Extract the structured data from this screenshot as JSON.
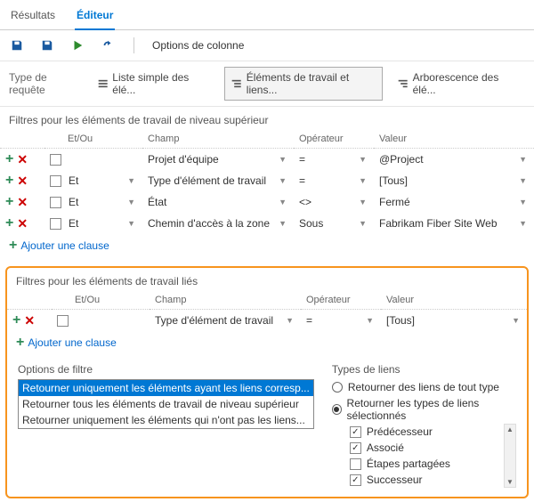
{
  "tabs": {
    "results": "Résultats",
    "editor": "Éditeur"
  },
  "toolbar": {
    "column_options": "Options de colonne"
  },
  "querytype": {
    "label": "Type de requête",
    "flat": "Liste simple des élé...",
    "links": "Éléments de travail et liens...",
    "tree": "Arborescence des élé..."
  },
  "top": {
    "title": "Filtres pour les éléments de travail de niveau supérieur",
    "headers": {
      "andor": "Et/Ou",
      "field": "Champ",
      "operator": "Opérateur",
      "value": "Valeur"
    },
    "rows": [
      {
        "andor": "",
        "field": "Projet d'équipe",
        "op": "=",
        "value": "@Project"
      },
      {
        "andor": "Et",
        "field": "Type d'élément de travail",
        "op": "=",
        "value": "[Tous]"
      },
      {
        "andor": "Et",
        "field": "État",
        "op": "<>",
        "value": "Fermé"
      },
      {
        "andor": "Et",
        "field": "Chemin d'accès à la zone",
        "op": "Sous",
        "value": "Fabrikam Fiber Site Web"
      }
    ],
    "add": "Ajouter une clause"
  },
  "linked": {
    "title": "Filtres pour les éléments de travail liés",
    "headers": {
      "andor": "Et/Ou",
      "field": "Champ",
      "operator": "Opérateur",
      "value": "Valeur"
    },
    "rows": [
      {
        "andor": "",
        "field": "Type d'élément de travail",
        "op": "=",
        "value": "[Tous]"
      }
    ],
    "add": "Ajouter une clause"
  },
  "filteropts": {
    "title": "Options de filtre",
    "items": [
      "Retourner uniquement les éléments ayant les liens corresp...",
      "Retourner tous les éléments de travail de niveau supérieur",
      "Retourner uniquement les éléments qui n'ont pas les liens..."
    ]
  },
  "linktypes": {
    "title": "Types de liens",
    "any": "Retourner des liens de tout type",
    "selected": "Retourner les types de liens sélectionnés",
    "items": [
      {
        "label": "Prédécesseur",
        "checked": true
      },
      {
        "label": "Associé",
        "checked": true
      },
      {
        "label": "Étapes partagées",
        "checked": false
      },
      {
        "label": "Successeur",
        "checked": true
      }
    ]
  }
}
